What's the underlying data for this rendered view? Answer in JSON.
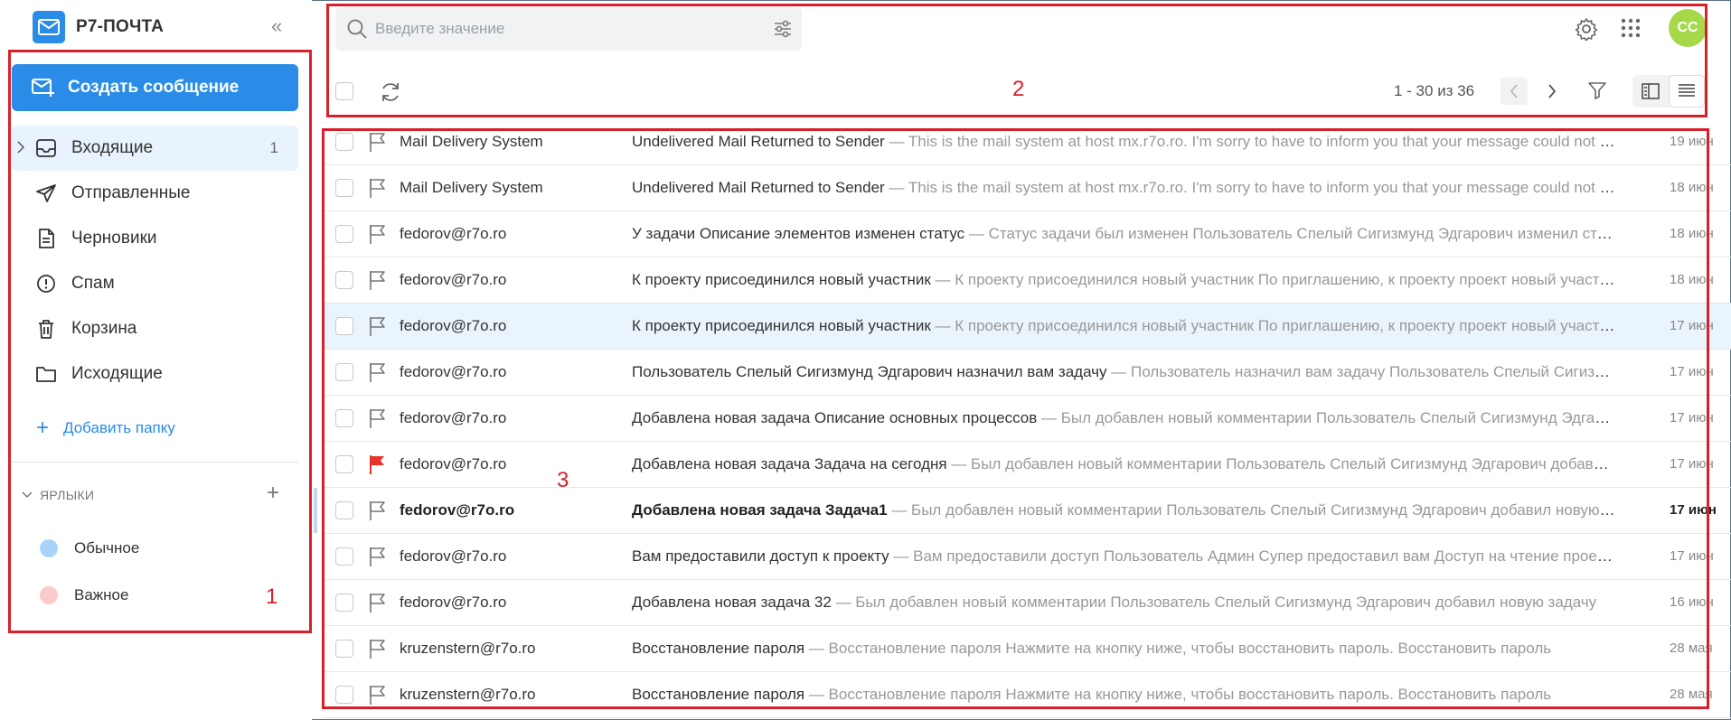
{
  "app": {
    "title": "Р7-ПОЧТА"
  },
  "sidebar": {
    "compose_label": "Создать сообщение",
    "folders": [
      {
        "label": "Входящие",
        "count": "1",
        "icon": "inbox-icon"
      },
      {
        "label": "Отправленные",
        "count": "",
        "icon": "send-icon"
      },
      {
        "label": "Черновики",
        "count": "",
        "icon": "document-icon"
      },
      {
        "label": "Спам",
        "count": "",
        "icon": "alert-circle-icon"
      },
      {
        "label": "Корзина",
        "count": "",
        "icon": "trash-icon"
      },
      {
        "label": "Исходящие",
        "count": "",
        "icon": "folder-icon"
      }
    ],
    "add_folder_label": "Добавить папку",
    "labels_header": "ЯРЛЫКИ",
    "labels": [
      {
        "label": "Обычное",
        "color": "#a8d4fa"
      },
      {
        "label": "Важное",
        "color": "#fbcaca"
      }
    ]
  },
  "search": {
    "placeholder": "Введите значение"
  },
  "user": {
    "initials": "СС",
    "avatar_color": "#a6d94a"
  },
  "toolbar": {
    "pagination": "1 - 30 из 36"
  },
  "colors": {
    "accent": "#2a8ce6",
    "annotation": "#d8202a",
    "flag_red": "#e8332c"
  },
  "annotations": [
    "1",
    "2",
    "3"
  ],
  "mails": [
    {
      "sender": "Mail Delivery System",
      "subject": "Undelivered Mail Returned to Sender",
      "preview": " — This is the mail system at host mx.r7o.ro. I'm sorry to have to inform you that your message could not be delivered",
      "date": "19 июн"
    },
    {
      "sender": "Mail Delivery System",
      "subject": "Undelivered Mail Returned to Sender",
      "preview": " — This is the mail system at host mx.r7o.ro. I'm sorry to have to inform you that your message could not be delivered",
      "date": "18 июн"
    },
    {
      "sender": "fedorov@r7o.ro",
      "subject": "У задачи Описание элементов изменен статус",
      "preview": " — Статус задачи был изменен Пользователь Спелый Сигизмунд Эдгарович изменил статус",
      "date": "18 июн"
    },
    {
      "sender": "fedorov@r7o.ro",
      "subject": "К проекту присоединился новый участник",
      "preview": " — К проекту присоединился новый участник По приглашению, к проекту проект новый участник",
      "date": "18 июн"
    },
    {
      "sender": "fedorov@r7o.ro",
      "subject": "К проекту присоединился новый участник",
      "preview": " — К проекту присоединился новый участник По приглашению, к проекту проект новый участник",
      "date": "17 июн"
    },
    {
      "sender": "fedorov@r7o.ro",
      "subject": "Пользователь Спелый Сигизмунд Эдгарович назначил вам задачу",
      "preview": " — Пользователь назначил вам задачу Пользователь Спелый Сигизмунд Эдгарович",
      "date": "17 июн"
    },
    {
      "sender": "fedorov@r7o.ro",
      "subject": "Добавлена новая задача Описание основных процессов",
      "preview": " — Был добавлен новый комментарии Пользователь Спелый Сигизмунд Эдгарович добавил",
      "date": "17 июн"
    },
    {
      "sender": "fedorov@r7o.ro",
      "subject": "Добавлена новая задача Задача на сегодня",
      "preview": " — Был добавлен новый комментарии Пользователь Спелый Сигизмунд Эдгарович добавил новую задачу",
      "date": "17 июн"
    },
    {
      "sender": "fedorov@r7o.ro",
      "subject": "Добавлена новая задача Задача1",
      "preview": " — Был добавлен новый комментарии Пользователь Спелый Сигизмунд Эдгарович добавил новую задачу",
      "date": "17 июн"
    },
    {
      "sender": "fedorov@r7o.ro",
      "subject": "Вам предоставили доступ к проекту",
      "preview": " — Вам предоставили доступ Пользователь Админ Супер предоставил вам Доступ на чтение проекта",
      "date": "17 июн"
    },
    {
      "sender": "fedorov@r7o.ro",
      "subject": "Добавлена новая задача 32",
      "preview": " — Был добавлен новый комментарии Пользователь Спелый Сигизмунд Эдгарович добавил новую задачу",
      "date": "16 июн"
    },
    {
      "sender": "kruzenstern@r7o.ro",
      "subject": "Восстановление пароля",
      "preview": " — Восстановление пароля Нажмите на кнопку ниже, чтобы восстановить пароль. Восстановить пароль",
      "date": "28 мая"
    },
    {
      "sender": "kruzenstern@r7o.ro",
      "subject": "Восстановление пароля",
      "preview": " — Восстановление пароля Нажмите на кнопку ниже, чтобы восстановить пароль. Восстановить пароль",
      "date": "28 мая"
    }
  ]
}
